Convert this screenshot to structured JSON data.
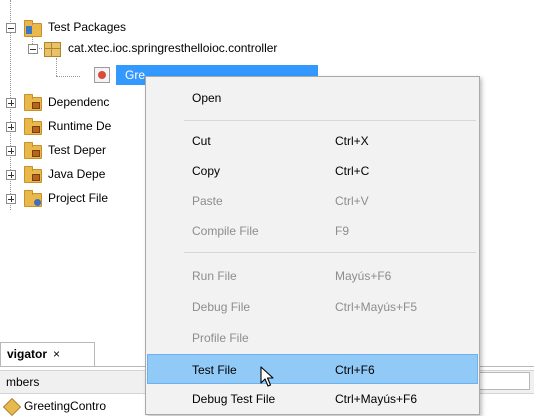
{
  "tree": {
    "test_packages": "Test Packages",
    "package_name": "cat.xtec.ioc.springresthelloioc.controller",
    "selected_file": "GreetingControllerTest.java",
    "selected_file_visible": "Gre",
    "dependencies": "Dependenc",
    "runtime_dependencies": "Runtime De",
    "test_dependencies": "Test Deper",
    "java_dependencies": "Java Depe",
    "project_files": "Project File"
  },
  "navigator": {
    "tab_label": "vigator",
    "close_glyph": "×",
    "members_label": "mbers",
    "row_label": "GreetingContro"
  },
  "context_menu": {
    "items": [
      {
        "label": "Open",
        "shortcut": "",
        "enabled": true
      },
      {
        "label": "Cut",
        "shortcut": "Ctrl+X",
        "enabled": true
      },
      {
        "label": "Copy",
        "shortcut": "Ctrl+C",
        "enabled": true
      },
      {
        "label": "Paste",
        "shortcut": "Ctrl+V",
        "enabled": false
      },
      {
        "label": "Compile File",
        "shortcut": "F9",
        "enabled": false
      },
      {
        "label": "Run File",
        "shortcut": "Mayús+F6",
        "enabled": false
      },
      {
        "label": "Debug File",
        "shortcut": "Ctrl+Mayús+F5",
        "enabled": false
      },
      {
        "label": "Profile File",
        "shortcut": "",
        "enabled": false
      },
      {
        "label": "Test File",
        "shortcut": "Ctrl+F6",
        "enabled": true,
        "highlighted": true
      },
      {
        "label": "Debug Test File",
        "shortcut": "Ctrl+Mayús+F6",
        "enabled": true
      }
    ]
  },
  "colors": {
    "selection": "#3399ff",
    "menu_highlight": "#91c9f7",
    "menu_background": "#f2f2f2",
    "disabled_text": "#8d8d8d"
  },
  "icons": {
    "folder": "folder-icon",
    "package": "package-icon",
    "java_file": "java-test-file-icon",
    "cursor": "mouse-pointer-icon"
  }
}
